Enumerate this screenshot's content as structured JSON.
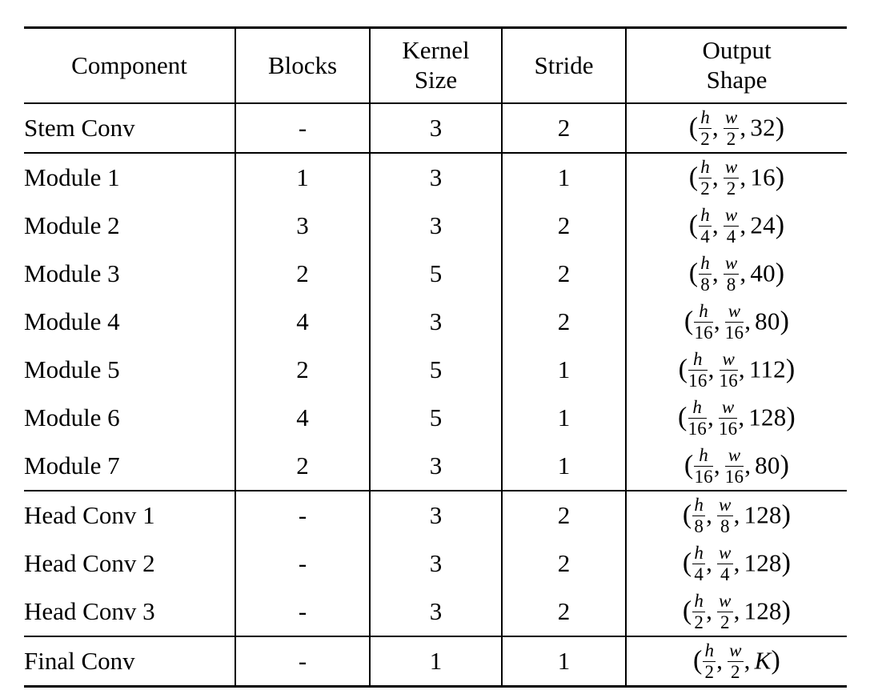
{
  "table": {
    "columns": [
      {
        "key": "component",
        "label_lines": [
          "Component"
        ]
      },
      {
        "key": "blocks",
        "label_lines": [
          "Blocks"
        ]
      },
      {
        "key": "kernel_size",
        "label_lines": [
          "Kernel",
          "Size"
        ]
      },
      {
        "key": "stride",
        "label_lines": [
          "Stride"
        ]
      },
      {
        "key": "output_shape",
        "label_lines": [
          "Output",
          "Shape"
        ]
      }
    ],
    "rows": [
      {
        "component": "Stem Conv",
        "blocks": "-",
        "kernel_size": "3",
        "stride": "2",
        "output_shape": {
          "h_num": "h",
          "h_den": "2",
          "w_num": "w",
          "w_den": "2",
          "channels": "32",
          "channels_italic": false
        },
        "output_shape_text": "(h/2, w/2, 32)"
      },
      {
        "component": "Module 1",
        "blocks": "1",
        "kernel_size": "3",
        "stride": "1",
        "output_shape": {
          "h_num": "h",
          "h_den": "2",
          "w_num": "w",
          "w_den": "2",
          "channels": "16",
          "channels_italic": false
        },
        "output_shape_text": "(h/2, w/2, 16)"
      },
      {
        "component": "Module 2",
        "blocks": "3",
        "kernel_size": "3",
        "stride": "2",
        "output_shape": {
          "h_num": "h",
          "h_den": "4",
          "w_num": "w",
          "w_den": "4",
          "channels": "24",
          "channels_italic": false
        },
        "output_shape_text": "(h/4, w/4, 24)"
      },
      {
        "component": "Module 3",
        "blocks": "2",
        "kernel_size": "5",
        "stride": "2",
        "output_shape": {
          "h_num": "h",
          "h_den": "8",
          "w_num": "w",
          "w_den": "8",
          "channels": "40",
          "channels_italic": false
        },
        "output_shape_text": "(h/8, w/8, 40)"
      },
      {
        "component": "Module 4",
        "blocks": "4",
        "kernel_size": "3",
        "stride": "2",
        "output_shape": {
          "h_num": "h",
          "h_den": "16",
          "w_num": "w",
          "w_den": "16",
          "channels": "80",
          "channels_italic": false
        },
        "output_shape_text": "(h/16, w/16, 80)"
      },
      {
        "component": "Module 5",
        "blocks": "2",
        "kernel_size": "5",
        "stride": "1",
        "output_shape": {
          "h_num": "h",
          "h_den": "16",
          "w_num": "w",
          "w_den": "16",
          "channels": "112",
          "channels_italic": false
        },
        "output_shape_text": "(h/16, w/16, 112)"
      },
      {
        "component": "Module 6",
        "blocks": "4",
        "kernel_size": "5",
        "stride": "1",
        "output_shape": {
          "h_num": "h",
          "h_den": "16",
          "w_num": "w",
          "w_den": "16",
          "channels": "128",
          "channels_italic": false
        },
        "output_shape_text": "(h/16, w/16, 128)"
      },
      {
        "component": "Module 7",
        "blocks": "2",
        "kernel_size": "3",
        "stride": "1",
        "output_shape": {
          "h_num": "h",
          "h_den": "16",
          "w_num": "w",
          "w_den": "16",
          "channels": "80",
          "channels_italic": false
        },
        "output_shape_text": "(h/16, w/16, 80)"
      },
      {
        "component": "Head Conv 1",
        "blocks": "-",
        "kernel_size": "3",
        "stride": "2",
        "output_shape": {
          "h_num": "h",
          "h_den": "8",
          "w_num": "w",
          "w_den": "8",
          "channels": "128",
          "channels_italic": false
        },
        "output_shape_text": "(h/8, w/8, 128)"
      },
      {
        "component": "Head Conv 2",
        "blocks": "-",
        "kernel_size": "3",
        "stride": "2",
        "output_shape": {
          "h_num": "h",
          "h_den": "4",
          "w_num": "w",
          "w_den": "4",
          "channels": "128",
          "channels_italic": false
        },
        "output_shape_text": "(h/4, w/4, 128)"
      },
      {
        "component": "Head Conv 3",
        "blocks": "-",
        "kernel_size": "3",
        "stride": "2",
        "output_shape": {
          "h_num": "h",
          "h_den": "2",
          "w_num": "w",
          "w_den": "2",
          "channels": "128",
          "channels_italic": false
        },
        "output_shape_text": "(h/2, w/2, 128)"
      },
      {
        "component": "Final Conv",
        "blocks": "-",
        "kernel_size": "1",
        "stride": "1",
        "output_shape": {
          "h_num": "h",
          "h_den": "2",
          "w_num": "w",
          "w_den": "2",
          "channels": "K",
          "channels_italic": true
        },
        "output_shape_text": "(h/2, w/2, K)"
      }
    ],
    "group_rule_after_row_index": [
      0,
      7,
      10
    ],
    "style": {
      "rule_color": "#000000",
      "text_color": "#000000",
      "background": "#ffffff"
    }
  }
}
